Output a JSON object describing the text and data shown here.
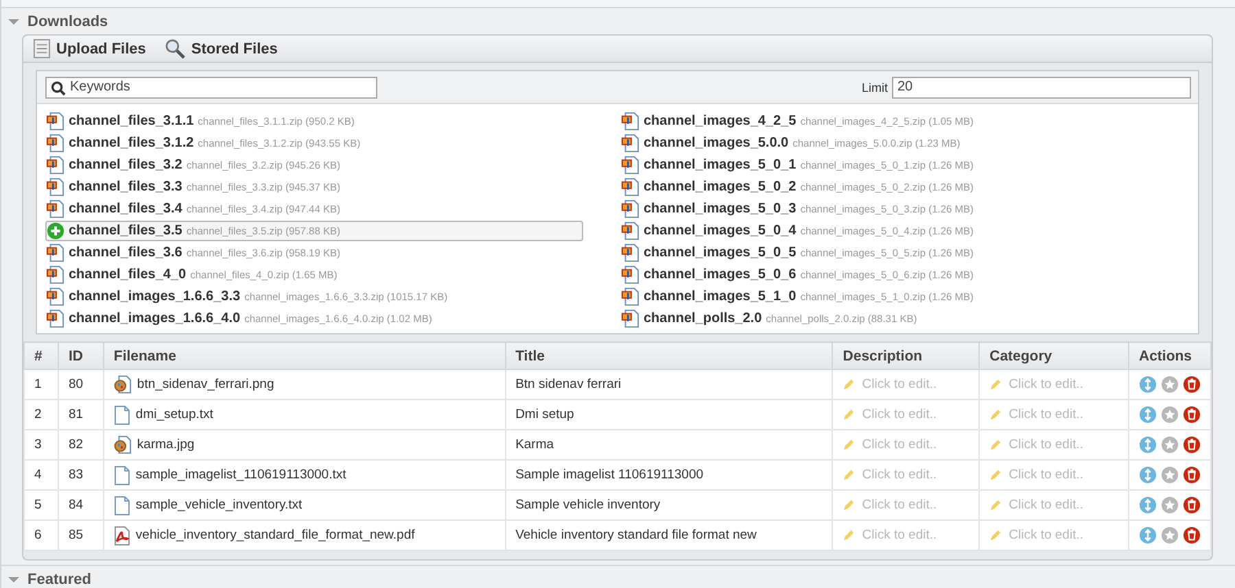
{
  "section": {
    "title": "Downloads",
    "expanded": true
  },
  "toolbar": [
    {
      "label": "Upload Files",
      "kind": "upload"
    },
    {
      "label": "Stored Files",
      "kind": "search"
    }
  ],
  "search": {
    "placeholder": "Keywords"
  },
  "limit": {
    "label": "Limit",
    "value": "20"
  },
  "files": [
    {
      "name": "channel_files_3.1.1",
      "detail": "channel_files_3.1.1.zip (950.2 KB)",
      "selected": false
    },
    {
      "name": "channel_files_3.1.2",
      "detail": "channel_files_3.1.2.zip (943.55 KB)",
      "selected": false
    },
    {
      "name": "channel_files_3.2",
      "detail": "channel_files_3.2.zip (945.26 KB)",
      "selected": false
    },
    {
      "name": "channel_files_3.3",
      "detail": "channel_files_3.3.zip (945.37 KB)",
      "selected": false
    },
    {
      "name": "channel_files_3.4",
      "detail": "channel_files_3.4.zip (947.44 KB)",
      "selected": false
    },
    {
      "name": "channel_files_3.5",
      "detail": "channel_files_3.5.zip (957.88 KB)",
      "selected": true
    },
    {
      "name": "channel_files_3.6",
      "detail": "channel_files_3.6.zip (958.19 KB)",
      "selected": false
    },
    {
      "name": "channel_files_4_0",
      "detail": "channel_files_4_0.zip (1.65 MB)",
      "selected": false
    },
    {
      "name": "channel_images_1.6.6_3.3",
      "detail": "channel_images_1.6.6_3.3.zip (1015.17 KB)",
      "selected": false
    },
    {
      "name": "channel_images_1.6.6_4.0",
      "detail": "channel_images_1.6.6_4.0.zip (1.02 MB)",
      "selected": false
    },
    {
      "name": "channel_images_4_2_5",
      "detail": "channel_images_4_2_5.zip (1.05 MB)",
      "selected": false
    },
    {
      "name": "channel_images_5.0.0",
      "detail": "channel_images_5.0.0.zip (1.23 MB)",
      "selected": false
    },
    {
      "name": "channel_images_5_0_1",
      "detail": "channel_images_5_0_1.zip (1.26 MB)",
      "selected": false
    },
    {
      "name": "channel_images_5_0_2",
      "detail": "channel_images_5_0_2.zip (1.26 MB)",
      "selected": false
    },
    {
      "name": "channel_images_5_0_3",
      "detail": "channel_images_5_0_3.zip (1.26 MB)",
      "selected": false
    },
    {
      "name": "channel_images_5_0_4",
      "detail": "channel_images_5_0_4.zip (1.26 MB)",
      "selected": false
    },
    {
      "name": "channel_images_5_0_5",
      "detail": "channel_images_5_0_5.zip (1.26 MB)",
      "selected": false
    },
    {
      "name": "channel_images_5_0_6",
      "detail": "channel_images_5_0_6.zip (1.26 MB)",
      "selected": false
    },
    {
      "name": "channel_images_5_1_0",
      "detail": "channel_images_5_1_0.zip (1.26 MB)",
      "selected": false
    },
    {
      "name": "channel_polls_2.0",
      "detail": "channel_polls_2.0.zip (88.31 KB)",
      "selected": false
    }
  ],
  "table": {
    "columns": [
      "#",
      "ID",
      "Filename",
      "Title",
      "Description",
      "Category",
      "Actions"
    ],
    "rows": [
      {
        "index": "1",
        "id": "80",
        "filename": "btn_sidenav_ferrari.png",
        "kind": "image",
        "title": "Btn sidenav ferrari",
        "description": "Click to edit..",
        "category": "Click to edit.."
      },
      {
        "index": "2",
        "id": "81",
        "filename": "dmi_setup.txt",
        "kind": "text",
        "title": "Dmi setup",
        "description": "Click to edit..",
        "category": "Click to edit.."
      },
      {
        "index": "3",
        "id": "82",
        "filename": "karma.jpg",
        "kind": "image",
        "title": "Karma",
        "description": "Click to edit..",
        "category": "Click to edit.."
      },
      {
        "index": "4",
        "id": "83",
        "filename": "sample_imagelist_110619113000.txt",
        "kind": "text",
        "title": "Sample imagelist 110619113000",
        "description": "Click to edit..",
        "category": "Click to edit.."
      },
      {
        "index": "5",
        "id": "84",
        "filename": "sample_vehicle_inventory.txt",
        "kind": "text",
        "title": "Sample vehicle inventory",
        "description": "Click to edit..",
        "category": "Click to edit.."
      },
      {
        "index": "6",
        "id": "85",
        "filename": "vehicle_inventory_standard_file_format_new.pdf",
        "kind": "pdf",
        "title": "Vehicle inventory standard file format new",
        "description": "Click to edit..",
        "category": "Click to edit.."
      }
    ]
  },
  "next_section": {
    "title": "Featured",
    "expanded": true
  }
}
